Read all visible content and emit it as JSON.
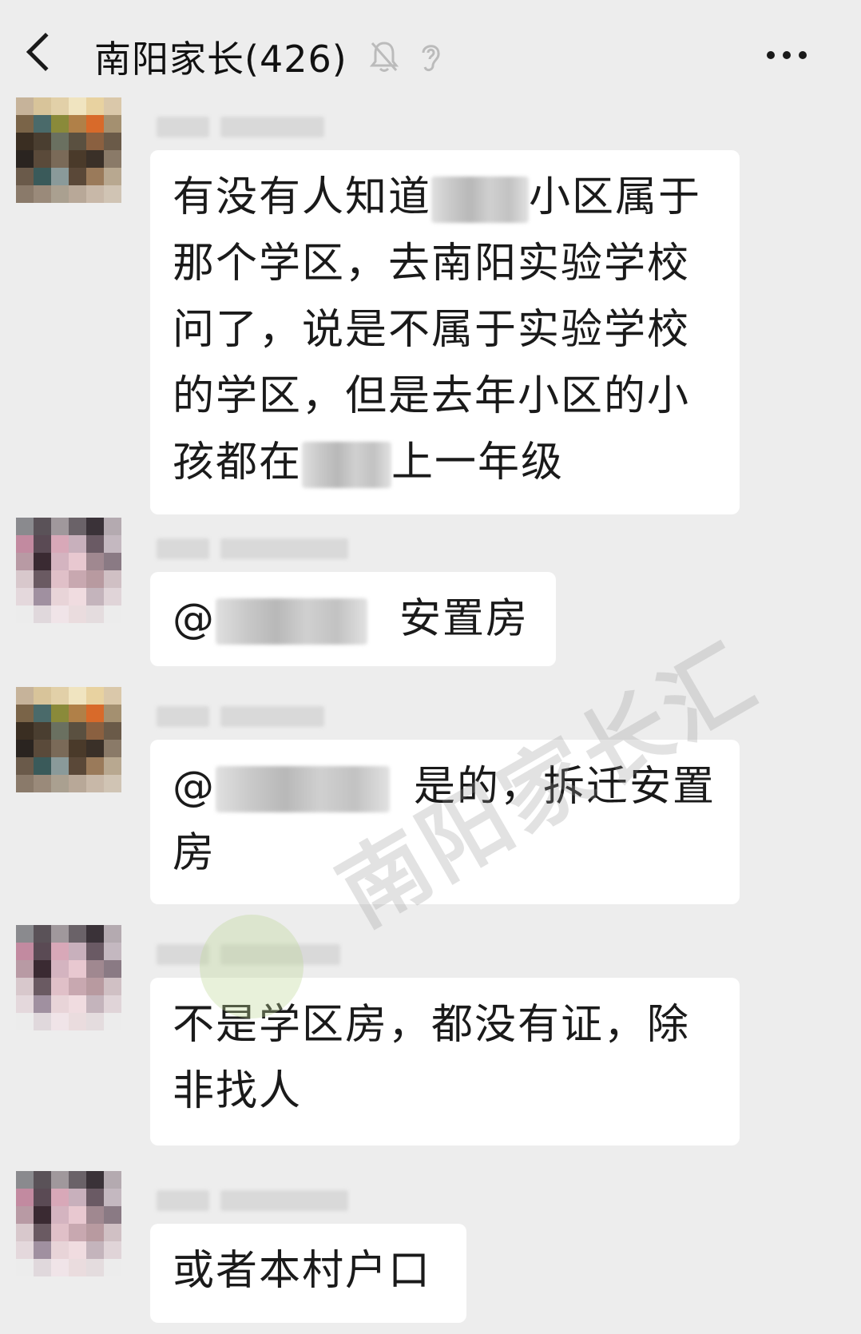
{
  "header": {
    "title": "南阳家长(426)",
    "icons": [
      "back-icon",
      "mute-icon",
      "ear-icon",
      "more-icon"
    ]
  },
  "messages": [
    {
      "segments": [
        "有没有人知道",
        "小区属于那个学区，去南阳实验学校问了，说是不属于实验学校的学区，但是去年小区的小孩都在",
        "上一年级"
      ]
    },
    {
      "segments": [
        "@",
        "安置房"
      ]
    },
    {
      "segments": [
        "@",
        "是的，拆迁安置房"
      ]
    },
    {
      "segments": [
        "不是学区房，都没有证，除非找人"
      ]
    },
    {
      "segments": [
        "或者本村户口"
      ]
    }
  ],
  "watermark": "南阳家长汇",
  "colors": {
    "background": "#ededed",
    "bubble": "#ffffff",
    "text": "#1a1a1a"
  }
}
